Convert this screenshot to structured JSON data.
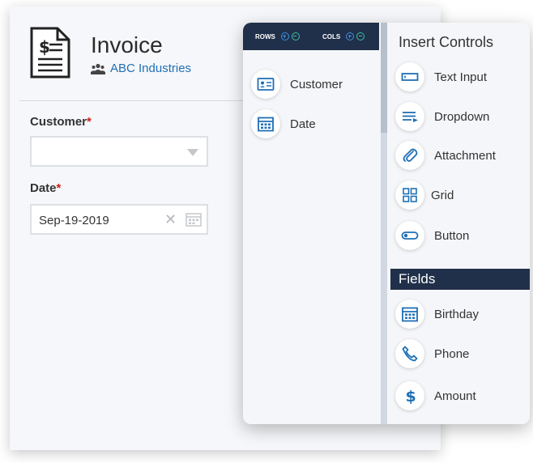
{
  "form": {
    "title": "Invoice",
    "company": "ABC Industries",
    "customer_label": "Customer",
    "customer_value": "",
    "date_label": "Date",
    "date_value": "Sep-19-2019",
    "required_mark": "*"
  },
  "panel": {
    "rows_label": "ROWS",
    "cols_label": "COLS",
    "layout_items": [
      {
        "label": "Customer",
        "icon": "contact-card-icon"
      },
      {
        "label": "Date",
        "icon": "calendar-icon"
      }
    ],
    "insert_controls_title": "Insert Controls",
    "controls": [
      {
        "label": "Text Input",
        "icon": "text-input-icon"
      },
      {
        "label": "Dropdown",
        "icon": "dropdown-icon"
      },
      {
        "label": "Attachment",
        "icon": "paperclip-icon"
      },
      {
        "label": "Grid",
        "icon": "grid-icon"
      },
      {
        "label": "Button",
        "icon": "button-toggle-icon"
      }
    ],
    "fields_title": "Fields",
    "fields": [
      {
        "label": "Birthday",
        "icon": "calendar-icon"
      },
      {
        "label": "Phone",
        "icon": "phone-icon"
      },
      {
        "label": "Amount",
        "icon": "dollar-icon"
      }
    ]
  },
  "colors": {
    "accent": "#1f6fb5",
    "header_bar": "#20304a",
    "required": "#d0201a"
  }
}
